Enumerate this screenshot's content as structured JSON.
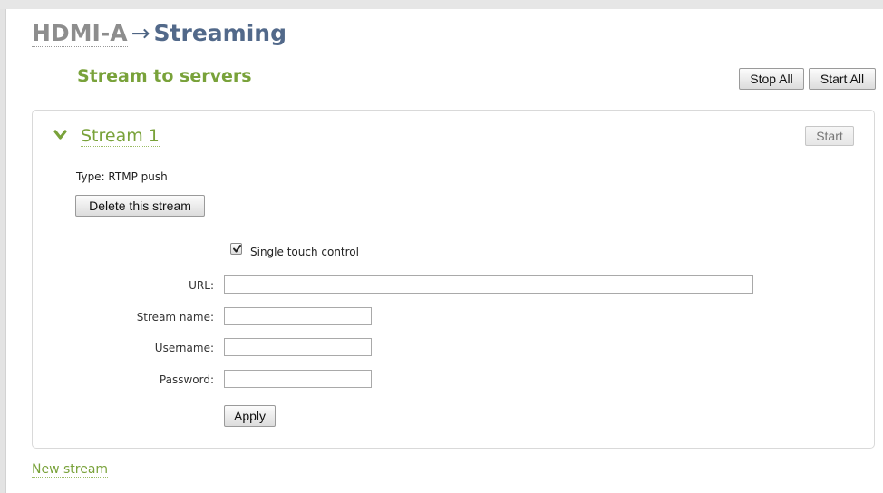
{
  "breadcrumb": {
    "parent": "HDMI-A",
    "arrow": "→",
    "current": "Streaming"
  },
  "section": {
    "title": "Stream to servers",
    "stop_all_label": "Stop All",
    "start_all_label": "Start All"
  },
  "stream": {
    "title": "Stream 1",
    "start_label": "Start",
    "type_line": "Type: RTMP push",
    "delete_label": "Delete this stream",
    "single_touch_label": "Single touch control",
    "single_touch_checked": true,
    "fields": {
      "url": {
        "label": "URL:",
        "value": ""
      },
      "stream_name": {
        "label": "Stream name:",
        "value": ""
      },
      "username": {
        "label": "Username:",
        "value": ""
      },
      "password": {
        "label": "Password:",
        "value": ""
      }
    },
    "apply_label": "Apply"
  },
  "new_stream_label": "New stream",
  "colors": {
    "accent_green": "#79a23a",
    "title_blue": "#52698a",
    "breadcrumb_gray": "#8d8d8d"
  },
  "icons": {
    "collapse": "chevron-down-icon",
    "check": "checkmark-icon"
  }
}
